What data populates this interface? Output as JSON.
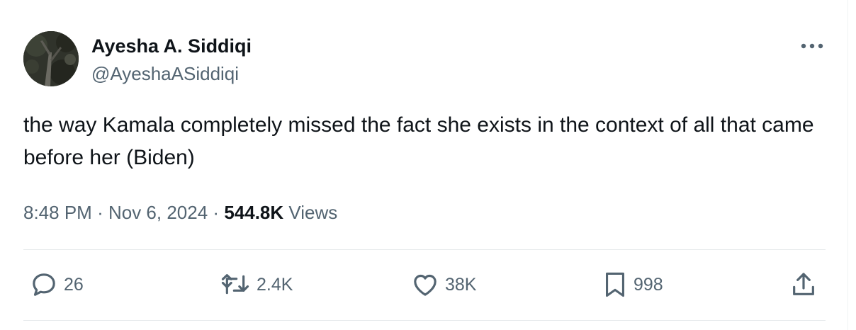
{
  "author": {
    "display_name": "Ayesha A. Siddiqi",
    "handle": "@AyeshaASiddiqi"
  },
  "tweet": {
    "text": "the way Kamala completely missed the fact she exists in the context of all that came before her (Biden)",
    "time": "8:48 PM",
    "separator": "·",
    "date": "Nov 6, 2024",
    "views_count": "544.8K",
    "views_label": "Views"
  },
  "actions": {
    "replies": "26",
    "reposts": "2.4K",
    "likes": "38K",
    "bookmarks": "998"
  },
  "icons": {
    "more": "more-horizontal-icon",
    "reply": "reply-bubble-icon",
    "repost": "repost-arrows-icon",
    "like": "heart-icon",
    "bookmark": "bookmark-icon",
    "share": "share-upload-icon"
  },
  "colors": {
    "text_primary": "#0f1419",
    "text_secondary": "#536471",
    "divider": "#e7eaec"
  }
}
